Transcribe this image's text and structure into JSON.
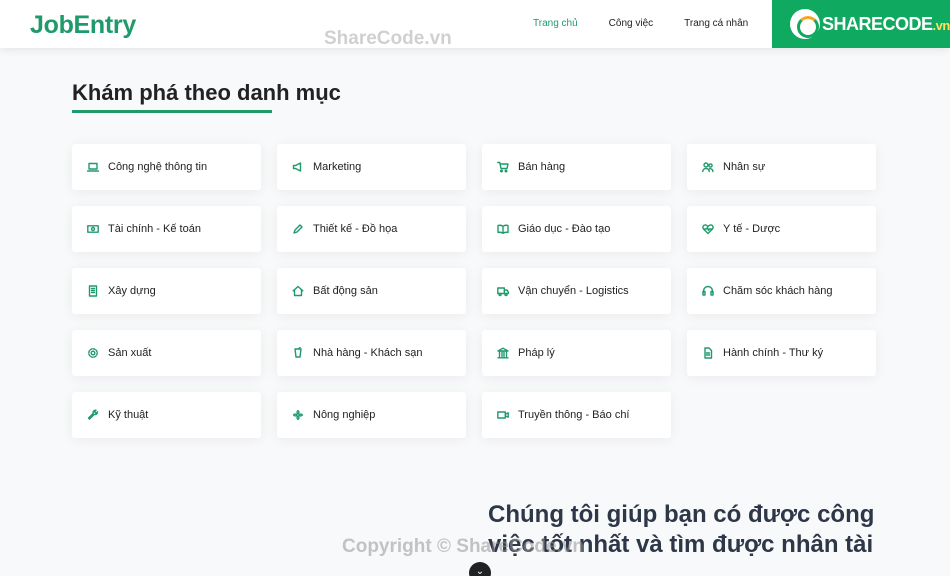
{
  "header": {
    "brand": "JobEntry",
    "nav": [
      {
        "label": "Trang chủ"
      },
      {
        "label": "Công việc"
      },
      {
        "label": "Trang cá nhân"
      }
    ],
    "active_color": "#1f9a6b"
  },
  "watermarks": {
    "top": "ShareCode.vn",
    "bottom": "Copyright © ShareCode.vn",
    "badge_main": "SHARECODE",
    "badge_suffix": ".vn"
  },
  "section": {
    "title": "Khám phá theo danh mục"
  },
  "categories": [
    {
      "label": "Công nghệ thông tin",
      "icon": "laptop-icon"
    },
    {
      "label": "Marketing",
      "icon": "megaphone-icon"
    },
    {
      "label": "Bán hàng",
      "icon": "cart-icon"
    },
    {
      "label": "Nhân sự",
      "icon": "users-icon"
    },
    {
      "label": "Tài chính - Kế toán",
      "icon": "money-icon"
    },
    {
      "label": "Thiết kế - Đồ họa",
      "icon": "pen-icon"
    },
    {
      "label": "Giáo dục - Đào tạo",
      "icon": "book-icon"
    },
    {
      "label": "Y tế - Dược",
      "icon": "heart-pulse-icon"
    },
    {
      "label": "Xây dựng",
      "icon": "building-icon"
    },
    {
      "label": "Bất động sản",
      "icon": "home-icon"
    },
    {
      "label": "Vận chuyển - Logistics",
      "icon": "truck-icon"
    },
    {
      "label": "Chăm sóc khách hàng",
      "icon": "headset-icon"
    },
    {
      "label": "Sản xuất",
      "icon": "gear-icon"
    },
    {
      "label": "Nhà hàng - Khách sạn",
      "icon": "cup-icon"
    },
    {
      "label": "Pháp lý",
      "icon": "courthouse-icon"
    },
    {
      "label": "Hành chính - Thư ký",
      "icon": "document-icon"
    },
    {
      "label": "Kỹ thuật",
      "icon": "wrench-icon"
    },
    {
      "label": "Nông nghiệp",
      "icon": "flower-icon"
    },
    {
      "label": "Truyền thông - Báo chí",
      "icon": "video-icon"
    }
  ],
  "help": {
    "title": "Chúng tôi giúp bạn có được công việc tốt nhất và tìm được nhân tài"
  }
}
